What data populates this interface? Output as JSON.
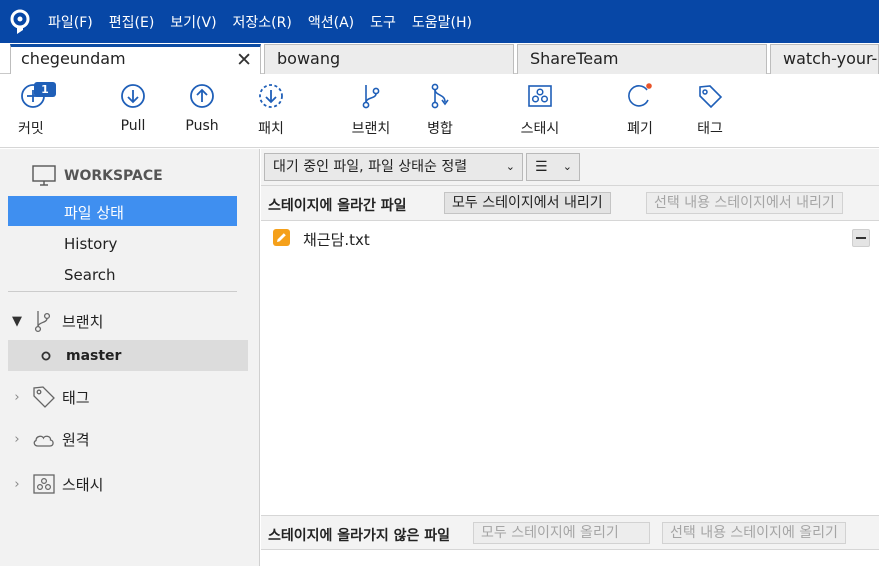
{
  "menubar": {
    "logo": "sourcetree-logo",
    "items": [
      "파일(F)",
      "편집(E)",
      "보기(V)",
      "저장소(R)",
      "액션(A)",
      "도구",
      "도움말(H)"
    ]
  },
  "tabs": [
    {
      "label": "chegeundam",
      "active": true
    },
    {
      "label": "bowang",
      "active": false
    },
    {
      "label": "ShareTeam",
      "active": false
    },
    {
      "label": "watch-your-",
      "active": false
    }
  ],
  "toolbar": {
    "commit": {
      "label": "커밋",
      "badge": "1"
    },
    "pull": "Pull",
    "push": "Push",
    "patch": "패치",
    "branch": "브랜치",
    "merge": "병합",
    "stash": "스태시",
    "discard": "폐기",
    "tag": "태그"
  },
  "sidebar": {
    "workspace_title": "WORKSPACE",
    "workspace_items": [
      "파일 상태",
      "History",
      "Search"
    ],
    "branches_title": "브랜치",
    "current_branch": "master",
    "tags_title": "태그",
    "remotes_title": "원격",
    "stashes_title": "스태시"
  },
  "main": {
    "filter_dropdown": "대기 중인 파일, 파일 상태순 정렬",
    "view_dropdown": "☰",
    "staged": {
      "title": "스테이지에 올라간 파일",
      "unstage_all": "모두 스테이지에서 내리기",
      "unstage_selected": "선택 내용 스테이지에서 내리기",
      "files": [
        {
          "name": "채근담.txt",
          "status": "modified"
        }
      ]
    },
    "unstaged": {
      "title": "스테이지에 올라가지 않은 파일",
      "stage_all": "모두 스테이지에 올리기",
      "stage_selected": "선택 내용 스테이지에 올리기"
    }
  },
  "colors": {
    "menubar": "#0747a6",
    "selection": "#3f8ff0",
    "icon_blue": "#1f5fb8",
    "modified_file": "#f5a01a",
    "discard_dot": "#e8542a"
  }
}
